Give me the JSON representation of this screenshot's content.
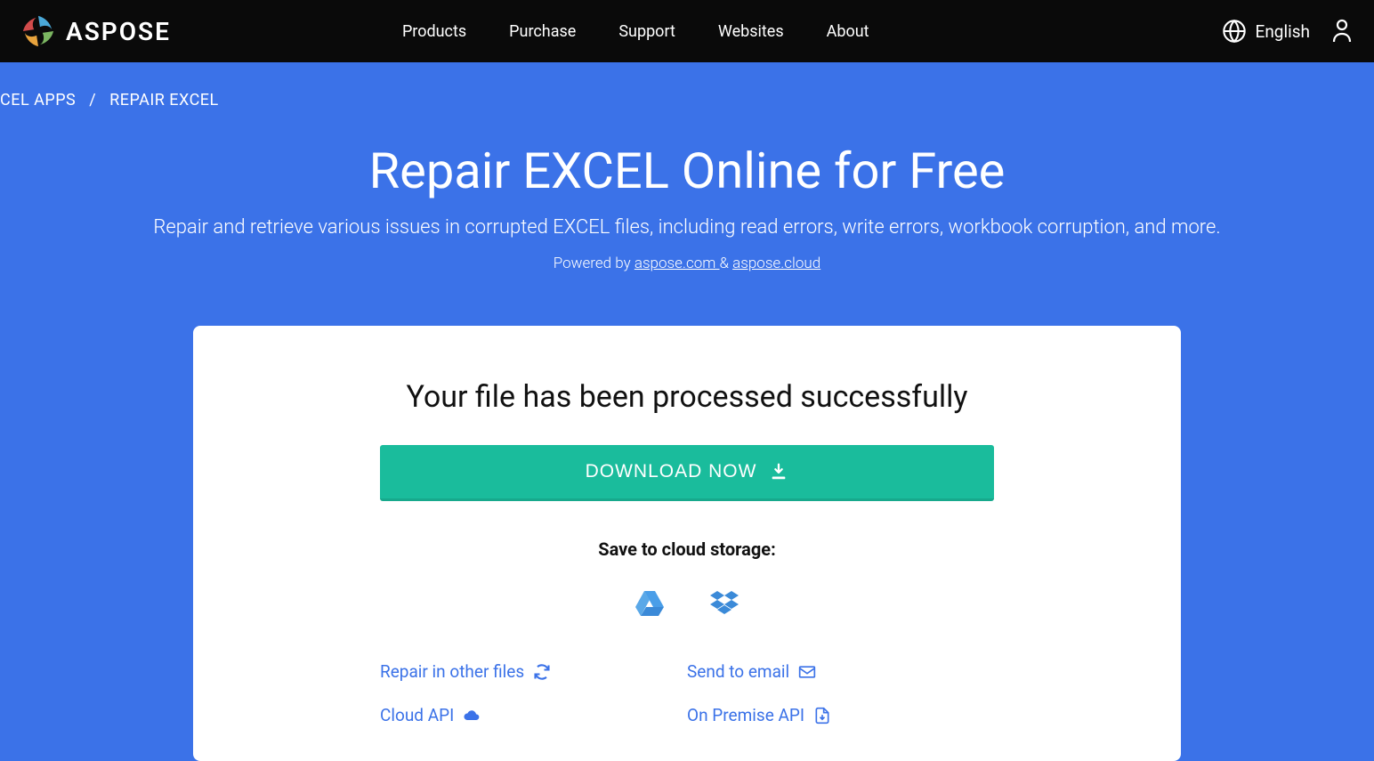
{
  "header": {
    "brand": "ASPOSE",
    "nav": {
      "products": "Products",
      "purchase": "Purchase",
      "support": "Support",
      "websites": "Websites",
      "about": "About"
    },
    "language": "English"
  },
  "breadcrumb": {
    "item1": "CEL APPS",
    "sep": "/",
    "item2": "REPAIR EXCEL"
  },
  "hero": {
    "title": "Repair EXCEL Online for Free",
    "subtitle": "Repair and retrieve various issues in corrupted EXCEL files, including read errors, write errors, workbook corruption, and more.",
    "powered_prefix": "Powered by ",
    "powered_link1": "aspose.com ",
    "powered_amp": "& ",
    "powered_link2": "aspose.cloud"
  },
  "card": {
    "success_title": "Your file has been processed successfully",
    "download_label": "DOWNLOAD NOW",
    "save_cloud_label": "Save to cloud storage:",
    "links": {
      "repair_other": "Repair in other files",
      "send_email": "Send to email",
      "cloud_api": "Cloud API",
      "on_premise": "On Premise API"
    }
  }
}
